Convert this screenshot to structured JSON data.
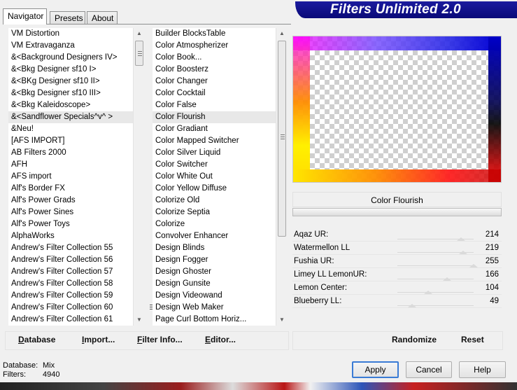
{
  "banner": {
    "title": "Filters Unlimited 2.0"
  },
  "tabs": [
    {
      "label": "Navigator",
      "active": true
    },
    {
      "label": "Presets",
      "active": false
    },
    {
      "label": "About",
      "active": false
    }
  ],
  "categories": [
    "VM Distortion",
    "VM Extravaganza",
    "&<Background Designers IV>",
    "&<Bkg Designer sf10 I>",
    "&<BKg Designer sf10 II>",
    "&<Bkg Designer sf10 III>",
    "&<Bkg Kaleidoscope>",
    "&<Sandflower Specials^v^ >",
    "&Neu!",
    "[AFS IMPORT]",
    "AB Filters 2000",
    "AFH",
    "AFS import",
    "Alf's Border FX",
    "Alf's Power Grads",
    "Alf's Power Sines",
    "Alf's Power Toys",
    "AlphaWorks",
    "Andrew's Filter Collection 55",
    "Andrew's Filter Collection 56",
    "Andrew's Filter Collection 57",
    "Andrew's Filter Collection 58",
    "Andrew's Filter Collection 59",
    "Andrew's Filter Collection 60",
    "Andrew's Filter Collection 61"
  ],
  "categories_selected_index": 7,
  "filters": [
    "Builder BlocksTable",
    "Color Atmospherizer",
    "Color Book...",
    "Color Boosterz",
    "Color Changer",
    "Color Cocktail",
    "Color False",
    "Color Flourish",
    "Color Gradiant",
    "Color Mapped Switcher",
    "Color Silver Liquid",
    "Color Switcher",
    "Color White Out",
    "Color Yellow Diffuse",
    "Colorize Old",
    "Colorize Septia",
    "Colorize",
    "Convolver Enhancer",
    "Design Blinds",
    "Design Fogger",
    "Design Ghoster",
    "Design Gunsite",
    "Design Videowand",
    "Design Web Maker",
    "Page Curl Bottom Horiz..."
  ],
  "filters_selected_index": 7,
  "current_filter": "Color Flourish",
  "params": [
    {
      "label": "Aqaz UR:",
      "value": "214",
      "level": 214
    },
    {
      "label": "Watermellon LL",
      "value": "219",
      "level": 219
    },
    {
      "label": "Fushia UR:",
      "value": "255",
      "level": 255
    },
    {
      "label": "Limey LL LemonUR:",
      "value": "166",
      "level": 166
    },
    {
      "label": "Lemon Center:",
      "value": "104",
      "level": 104
    },
    {
      "label": "Blueberry LL:",
      "value": "49",
      "level": 49
    }
  ],
  "toolbar": {
    "database_label": "Database",
    "database_key": "D",
    "import_label": "Import...",
    "import_key": "I",
    "filter_info_label": "Filter Info...",
    "filter_info_key": "F",
    "editor_label": "Editor...",
    "editor_key": "E",
    "randomize_label": "Randomize",
    "reset_label": "Reset"
  },
  "status": {
    "database_label": "Database:",
    "database_value": "Mix",
    "filters_label": "Filters:",
    "filters_value": "4940"
  },
  "buttons": {
    "apply": "Apply",
    "cancel": "Cancel",
    "help": "Help"
  },
  "colors": {
    "banner": "#0a0a78",
    "default_button_border": "#3a7bd5"
  }
}
